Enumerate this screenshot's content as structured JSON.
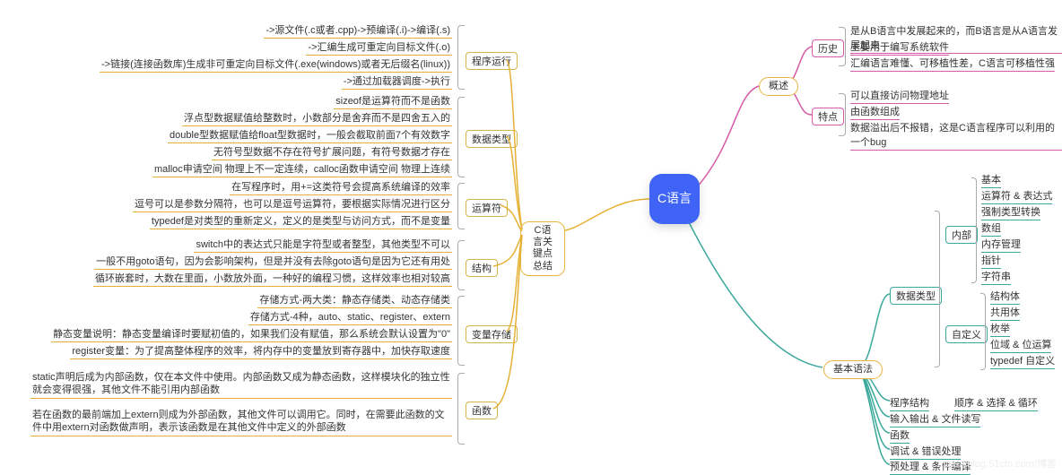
{
  "central": {
    "title": "C语言"
  },
  "primary": {
    "keypoints": "C语言关\n键点总结",
    "overview": "概述",
    "syntax": "基本语法"
  },
  "overview": {
    "history": {
      "label": "历史",
      "items": [
        "是从B语言中发展起来的，而B语言是从A语言发展起来",
        "主要用于编写系统软件",
        "汇编语言难懂、可移植性差，C语言可移植性强"
      ]
    },
    "features": {
      "label": "特点",
      "items": [
        "可以直接访问物理地址",
        "由函数组成",
        "数据溢出后不报错，这是C语言程序可以利用的一个bug"
      ]
    }
  },
  "syntax": {
    "datatype": {
      "label": "数据类型",
      "inner": {
        "label": "内部",
        "items": [
          "基本",
          "运算符 & 表达式",
          "强制类型转换",
          "数组",
          "内存管理",
          "指针",
          "字符串"
        ]
      },
      "custom": {
        "label": "自定义",
        "items": [
          "结构体",
          "共用体",
          "枚举",
          "位域 & 位运算",
          "typedef 自定义"
        ]
      }
    },
    "struct": {
      "label": "程序结构",
      "note": "顺序 & 选择 & 循环"
    },
    "io": {
      "label": "输入输出 & 文件读写"
    },
    "func": {
      "label": "函数"
    },
    "debug": {
      "label": "调试 & 错误处理"
    },
    "pre": {
      "label": "预处理 & 条件编译"
    }
  },
  "key": {
    "run": {
      "label": "程序运行",
      "items": [
        "->源文件(.c或者.cpp)->预编译(.i)->编译(.s)",
        "->汇编生成可重定向目标文件(.o)",
        "->链接(连接函数库)生成非可重定向目标文件(.exe(windows)或者无后缀名(linux))",
        "->通过加载器调度->执行"
      ]
    },
    "types": {
      "label": "数据类型",
      "items": [
        "sizeof是运算符而不是函数",
        "浮点型数据赋值给整数时，小数部分是舍弃而不是四舍五入的",
        "double型数据赋值给float型数据时，一般会截取前面7个有效数字",
        "无符号型数据不存在符号扩展问题，有符号数据才存在",
        "malloc申请空间 物理上不一定连续，calloc函数申请空间 物理上连续"
      ]
    },
    "op": {
      "label": "运算符",
      "items": [
        "在写程序时，用+=这类符号会提高系统编译的效率",
        "逗号可以是参数分隔符，也可以是逗号运算符，要根据实际情况进行区分",
        "typedef是对类型的重新定义，定义的是类型与访问方式，而不是变量"
      ]
    },
    "struct": {
      "label": "结构",
      "items": [
        "switch中的表达式只能是字符型或者整型，其他类型不可以",
        "一般不用goto语句，因为会影响架构，但是并没有去除goto语句是因为它还有用处",
        "循环嵌套时，大数在里面，小数放外面，一种好的编程习惯，这样效率也相对较高"
      ]
    },
    "store": {
      "label": "变量存储",
      "items": [
        "存储方式-两大类：静态存储类、动态存储类",
        "存储方式-4种，auto、static、register、extern",
        "静态变量说明：静态变量编译时要赋初值的，如果我们没有赋值，那么系统会默认设置为\"0\"",
        "register变量：为了提高整体程序的效率，将内存中的变量放到寄存器中，加快存取速度"
      ]
    },
    "func": {
      "label": "函数",
      "items": [
        "static声明后成为内部函数，仅在本文件中使用。内部函数又成为静态函数，这样模块化的独立性就会变得很强，其他文件不能引用内部函数",
        "若在函数的最前端加上extern则成为外部函数，其他文件可以调用它。同时，在需要此函数的文件中用extern对函数做声明，表示该函数是在其他文件中定义的外部函数"
      ]
    }
  }
}
